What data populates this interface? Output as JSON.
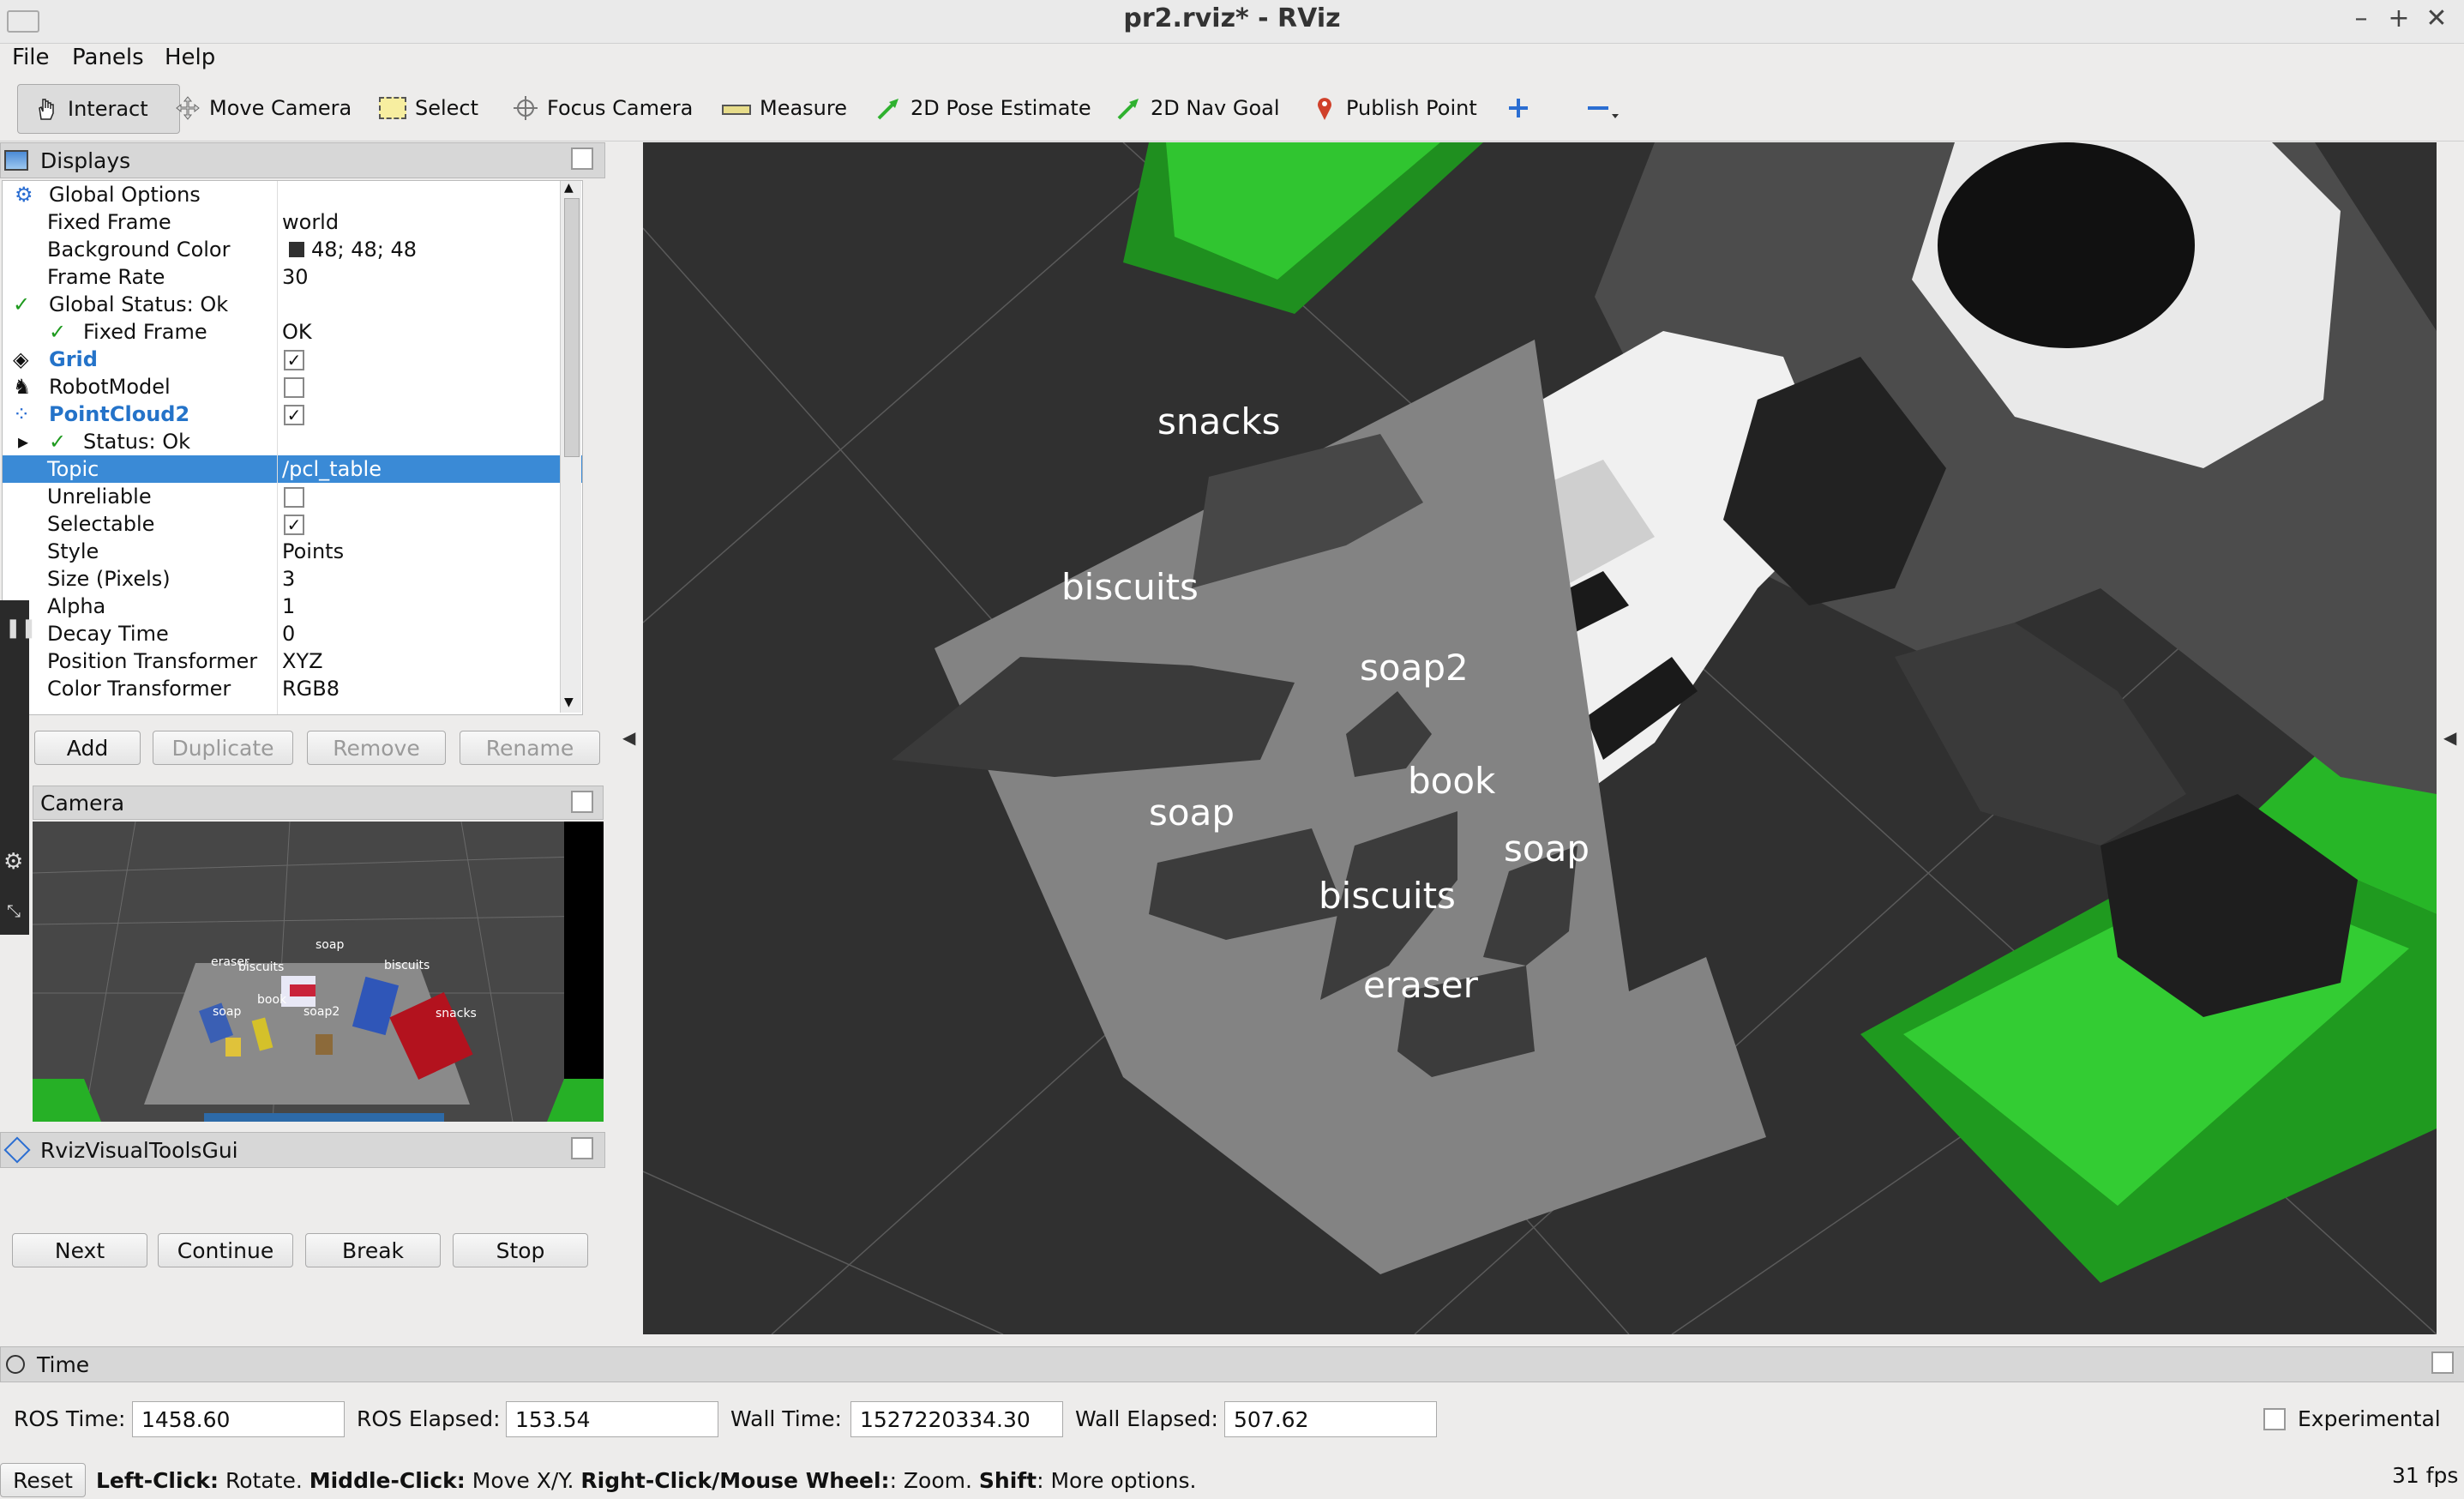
{
  "window": {
    "title": "pr2.rviz* - RViz"
  },
  "menubar": [
    "File",
    "Panels",
    "Help"
  ],
  "toolbar": {
    "interact": "Interact",
    "move_camera": "Move Camera",
    "select": "Select",
    "focus_camera": "Focus Camera",
    "measure": "Measure",
    "pose_estimate": "2D Pose Estimate",
    "nav_goal": "2D Nav Goal",
    "publish_point": "Publish Point"
  },
  "displays": {
    "title": "Displays",
    "rows": [
      {
        "name": "Global Options"
      },
      {
        "name": "Fixed Frame",
        "value": "world"
      },
      {
        "name": "Background Color",
        "value": "48; 48; 48"
      },
      {
        "name": "Frame Rate",
        "value": "30"
      },
      {
        "name": "Global Status: Ok"
      },
      {
        "name": "Fixed Frame",
        "value": "OK"
      },
      {
        "name": "Grid",
        "checked": true
      },
      {
        "name": "RobotModel",
        "checked": false
      },
      {
        "name": "PointCloud2",
        "checked": true
      },
      {
        "name": "Status: Ok"
      },
      {
        "name": "Topic",
        "value": "/pcl_table"
      },
      {
        "name": "Unreliable",
        "checked": false
      },
      {
        "name": "Selectable",
        "checked": true
      },
      {
        "name": "Style",
        "value": "Points"
      },
      {
        "name": "Size (Pixels)",
        "value": "3"
      },
      {
        "name": "Alpha",
        "value": "1"
      },
      {
        "name": "Decay Time",
        "value": "0"
      },
      {
        "name": "Position Transformer",
        "value": "XYZ"
      },
      {
        "name": "Color Transformer",
        "value": "RGB8"
      }
    ],
    "buttons": [
      "Add",
      "Duplicate",
      "Remove",
      "Rename"
    ],
    "background_color": "#303030"
  },
  "camera_panel": {
    "title": "Camera",
    "labels": [
      "eraser",
      "biscuits",
      "soap",
      "biscuits",
      "book",
      "soap2",
      "soap",
      "snacks"
    ]
  },
  "visual_tools": {
    "title": "RvizVisualToolsGui",
    "buttons": [
      "Next",
      "Continue",
      "Break",
      "Stop"
    ]
  },
  "viewport": {
    "labels": [
      {
        "text": "snacks"
      },
      {
        "text": "biscuits"
      },
      {
        "text": "soap2"
      },
      {
        "text": "soap"
      },
      {
        "text": "book"
      },
      {
        "text": "soap"
      },
      {
        "text": "biscuits"
      },
      {
        "text": "eraser"
      }
    ]
  },
  "time_panel": {
    "title": "Time",
    "ros_time_label": "ROS Time:",
    "ros_time": "1458.60",
    "ros_elapsed_label": "ROS Elapsed:",
    "ros_elapsed": "153.54",
    "wall_time_label": "Wall Time:",
    "wall_time": "1527220334.30",
    "wall_elapsed_label": "Wall Elapsed:",
    "wall_elapsed": "507.62",
    "experimental": "Experimental"
  },
  "statusbar": {
    "reset": "Reset",
    "b1": "Left-Click:",
    "t1": " Rotate. ",
    "b2": "Middle-Click:",
    "t2": " Move X/Y. ",
    "b3": "Right-Click/Mouse Wheel:",
    "t3": ": Zoom. ",
    "b4": "Shift",
    "t4": ": More options.",
    "fps": "31 fps"
  },
  "colors": {
    "accent": "#3a8ad6",
    "green": "#2fc12f",
    "viewport_bg": "#303030"
  }
}
